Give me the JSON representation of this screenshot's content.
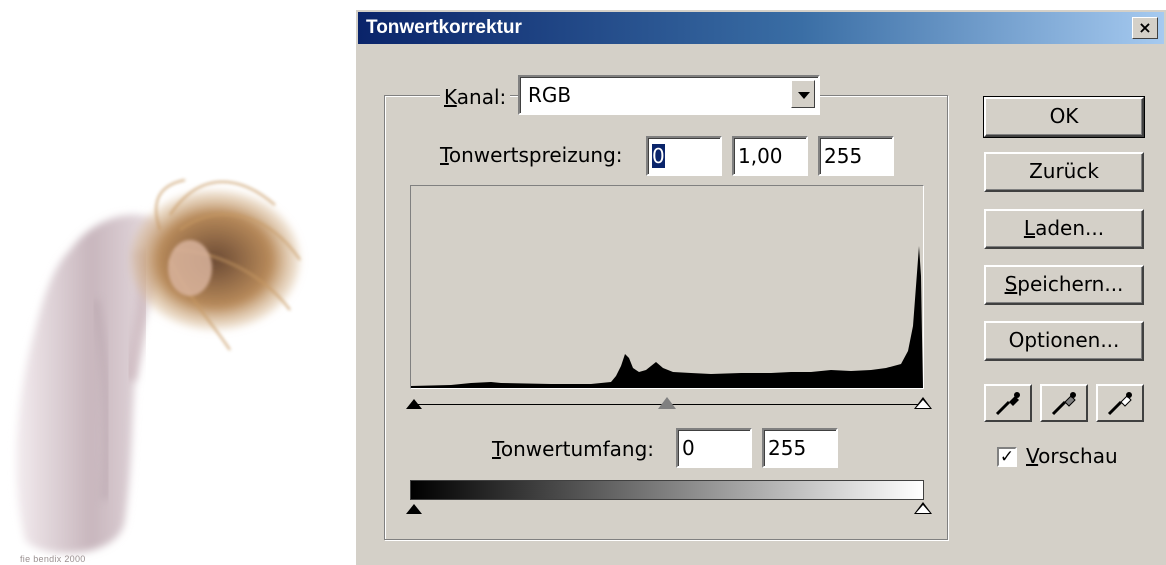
{
  "photo": {
    "watermark": "fie bendix 2000"
  },
  "dialog": {
    "title": "Tonwertkorrektur",
    "close_glyph": "×",
    "kanal": {
      "label_u": "K",
      "label_rest": "anal:",
      "value": "RGB"
    },
    "input_levels": {
      "label_u": "T",
      "label_rest": "onwertspreizung:",
      "black": "0",
      "gamma": "1,00",
      "white": "255"
    },
    "output_levels": {
      "label_u": "T",
      "label_rest": "onwertumfang:",
      "black": "0",
      "white": "255"
    },
    "buttons": {
      "ok": "OK",
      "reset": "Zurück",
      "load_u": "L",
      "load_rest": "aden...",
      "save_u": "S",
      "save_rest": "peichern...",
      "options": "Optionen..."
    },
    "eyedroppers": [
      "black-point-eyedropper-icon",
      "gray-point-eyedropper-icon",
      "white-point-eyedropper-icon"
    ],
    "preview": {
      "checked": true,
      "check_glyph": "✓",
      "label_u": "V",
      "label_rest": "orschau"
    },
    "colors": {
      "face": "#d4d0c8",
      "title_start": "#0a246a",
      "title_end": "#a6caf0",
      "selection": "#0a246a"
    }
  }
}
